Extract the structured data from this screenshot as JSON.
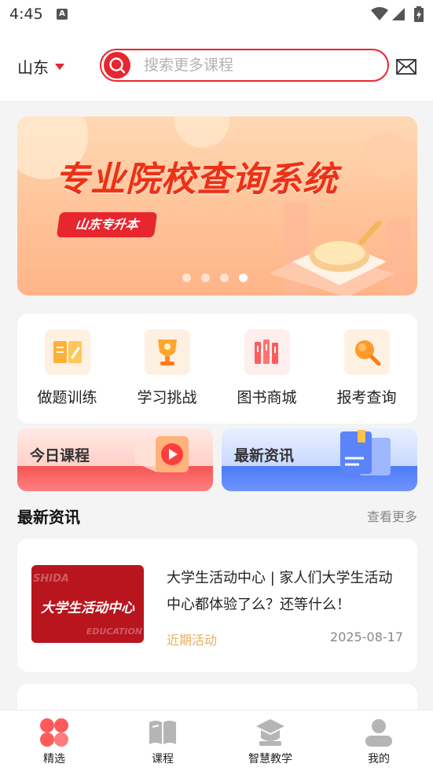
{
  "status_bar": {
    "time": "4:45",
    "sim_badge": "A"
  },
  "header": {
    "region": "山东",
    "search_placeholder": "搜索更多课程"
  },
  "banner": {
    "title": "专业院校查询系统",
    "tag": "山东专升本",
    "dot_count": 4,
    "active_dot_index": 3
  },
  "quick_menu": [
    {
      "label": "做题训练",
      "icon": "notebook-icon"
    },
    {
      "label": "学习挑战",
      "icon": "trophy-icon"
    },
    {
      "label": "图书商城",
      "icon": "books-icon"
    },
    {
      "label": "报考查询",
      "icon": "magnifier-icon"
    }
  ],
  "promos": [
    {
      "label": "今日课程",
      "icon": "play-icon"
    },
    {
      "label": "最新资讯",
      "icon": "document-icon"
    }
  ],
  "news_section": {
    "title": "最新资讯",
    "more": "查看更多"
  },
  "news": [
    {
      "title": "大学生活动中心 | 家人们大学生活动中心都体验了么？还等什么！",
      "thumb_text": "大学生活动中心",
      "thumb_watermark_1": "SHIDA",
      "thumb_watermark_2": "EDUCATION",
      "tag": "近期活动",
      "date": "2025-08-17"
    }
  ],
  "tabbar": [
    {
      "label": "精选",
      "icon": "grid-icon",
      "active": true
    },
    {
      "label": "课程",
      "icon": "book-icon",
      "active": false
    },
    {
      "label": "智慧教学",
      "icon": "graduation-cap-icon",
      "active": false
    },
    {
      "label": "我的",
      "icon": "user-icon",
      "active": false
    }
  ],
  "colors": {
    "brand_red": "#e7262f",
    "tag_gold": "#e6b060",
    "bg": "#f4f4f4"
  }
}
